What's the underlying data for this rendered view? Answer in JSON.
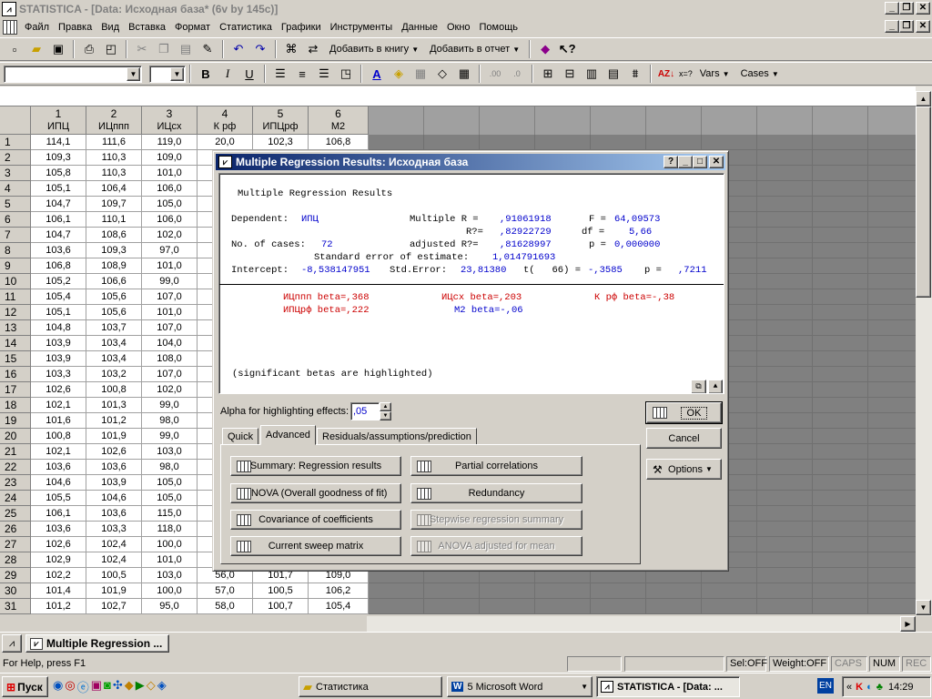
{
  "window": {
    "title": "STATISTICA - [Data: Исходная база* (6v by 145c)]",
    "icon": "statistica-icon"
  },
  "menu": [
    "Файл",
    "Правка",
    "Вид",
    "Вставка",
    "Формат",
    "Статистика",
    "Графики",
    "Инструменты",
    "Данные",
    "Окно",
    "Помощь"
  ],
  "toolbar1": {
    "add_to_workbook": "Добавить в книгу",
    "add_to_report": "Добавить в отчет"
  },
  "toolbar2": {
    "vars": "Vars",
    "cases": "Cases",
    "xeq": "x=?"
  },
  "sheet": {
    "columns": [
      {
        "num": "1",
        "name": "ИПЦ"
      },
      {
        "num": "2",
        "name": "ИЦппп"
      },
      {
        "num": "3",
        "name": "ИЦсх"
      },
      {
        "num": "4",
        "name": "К рф"
      },
      {
        "num": "5",
        "name": "ИПЦрф"
      },
      {
        "num": "6",
        "name": "М2"
      }
    ],
    "rows": [
      [
        "1",
        "114,1",
        "111,6",
        "119,0",
        "20,0",
        "102,3",
        "106,8"
      ],
      [
        "2",
        "109,3",
        "110,3",
        "109,0",
        "",
        "",
        ""
      ],
      [
        "3",
        "105,8",
        "110,3",
        "101,0",
        "",
        "",
        ""
      ],
      [
        "4",
        "105,1",
        "106,4",
        "106,0",
        "",
        "",
        ""
      ],
      [
        "5",
        "104,7",
        "109,7",
        "105,0",
        "",
        "",
        ""
      ],
      [
        "6",
        "106,1",
        "110,1",
        "106,0",
        "",
        "",
        ""
      ],
      [
        "7",
        "104,7",
        "108,6",
        "102,0",
        "",
        "",
        ""
      ],
      [
        "8",
        "103,6",
        "109,3",
        "97,0",
        "",
        "",
        ""
      ],
      [
        "9",
        "106,8",
        "108,9",
        "101,0",
        "",
        "",
        ""
      ],
      [
        "10",
        "105,2",
        "106,6",
        "99,0",
        "",
        "",
        ""
      ],
      [
        "11",
        "105,4",
        "105,6",
        "107,0",
        "",
        "",
        ""
      ],
      [
        "12",
        "105,1",
        "105,6",
        "101,0",
        "",
        "",
        ""
      ],
      [
        "13",
        "104,8",
        "103,7",
        "107,0",
        "",
        "",
        ""
      ],
      [
        "14",
        "103,9",
        "103,4",
        "104,0",
        "",
        "",
        ""
      ],
      [
        "15",
        "103,9",
        "103,4",
        "108,0",
        "",
        "",
        ""
      ],
      [
        "16",
        "103,3",
        "103,2",
        "107,0",
        "",
        "",
        ""
      ],
      [
        "17",
        "102,6",
        "100,8",
        "102,0",
        "",
        "",
        ""
      ],
      [
        "18",
        "102,1",
        "101,3",
        "99,0",
        "",
        "",
        ""
      ],
      [
        "19",
        "101,6",
        "101,2",
        "98,0",
        "",
        "",
        ""
      ],
      [
        "20",
        "100,8",
        "101,9",
        "99,0",
        "",
        "",
        ""
      ],
      [
        "21",
        "102,1",
        "102,6",
        "103,0",
        "",
        "",
        ""
      ],
      [
        "22",
        "103,6",
        "103,6",
        "98,0",
        "",
        "",
        ""
      ],
      [
        "23",
        "104,6",
        "103,9",
        "105,0",
        "",
        "",
        ""
      ],
      [
        "24",
        "105,5",
        "104,6",
        "105,0",
        "",
        "",
        ""
      ],
      [
        "25",
        "106,1",
        "103,6",
        "115,0",
        "",
        "",
        ""
      ],
      [
        "26",
        "103,6",
        "103,3",
        "118,0",
        "",
        "",
        ""
      ],
      [
        "27",
        "102,6",
        "102,4",
        "100,0",
        "",
        "",
        ""
      ],
      [
        "28",
        "102,9",
        "102,4",
        "101,0",
        "",
        "",
        ""
      ],
      [
        "29",
        "102,2",
        "100,5",
        "103,0",
        "56,0",
        "101,7",
        "109,0"
      ],
      [
        "30",
        "101,4",
        "101,9",
        "100,0",
        "57,0",
        "100,5",
        "106,2"
      ],
      [
        "31",
        "101,2",
        "102,7",
        "95,0",
        "58,0",
        "100,7",
        "105,4"
      ]
    ]
  },
  "dialog": {
    "title": "Multiple Regression Results: Исходная база",
    "report": {
      "heading": "Multiple Regression Results",
      "dependent_label": "Dependent:",
      "dependent": "ИПЦ",
      "multiple_r_label": "Multiple R =",
      "multiple_r": ",91061918",
      "f_label": "F =",
      "f": "64,09573",
      "r2_label": "R?=",
      "r2": ",82922729",
      "df_label": "df =",
      "df": "5,66",
      "cases_label": "No. of cases:",
      "cases": "72",
      "adj_r2_label": "adjusted R?=",
      "adj_r2": ",81628997",
      "p_label": "p =",
      "p": "0,000000",
      "se_label": "Standard error of estimate:",
      "se": "1,014791693",
      "intercept_label": "Intercept:",
      "intercept": "-8,538147951",
      "std_err_label": "Std.Error:",
      "std_err": "23,81380",
      "t_label": "t(   66) =",
      "t": "-,3585",
      "p2_label": "p =",
      "p2": ",7211",
      "betas": [
        {
          "text": "ИЦппп beta=,368",
          "highlighted": true
        },
        {
          "text": "ИЦсх beta=,203",
          "highlighted": true
        },
        {
          "text": "К рф beta=-,38",
          "highlighted": true
        },
        {
          "text": "ИПЦрф beta=,222",
          "highlighted": true
        },
        {
          "text": "М2 beta=-,06",
          "highlighted": false
        }
      ],
      "note": "(significant betas are highlighted)"
    },
    "alpha_label": "Alpha for highlighting effects:",
    "alpha_value": ",05",
    "tabs": [
      "Quick",
      "Advanced",
      "Residuals/assumptions/prediction"
    ],
    "active_tab": "Advanced",
    "buttons": {
      "summary": "Summary:  Regression results",
      "anova": "ANOVA (Overall goodness of fit)",
      "covariance": "Covariance of coefficients",
      "sweep": "Current sweep matrix",
      "partial": "Partial correlations",
      "redundancy": "Redundancy",
      "stepwise": "Stepwise regression summary",
      "anova_mean": "ANOVA adjusted for mean"
    },
    "ok": "OK",
    "cancel": "Cancel",
    "options": "Options"
  },
  "mdi_task": "Multiple Regression ...",
  "status": {
    "help": "For Help, press F1",
    "sel": "Sel:OFF",
    "weight": "Weight:OFF",
    "caps": "CAPS",
    "num": "NUM",
    "rec": "REC"
  },
  "taskbar": {
    "start": "Пуск",
    "t1": "Статистика",
    "t2": "5 Microsoft Word",
    "t3": "STATISTICA - [Data: ...",
    "lang": "EN",
    "time": "14:29"
  },
  "colors": {
    "beta_highlight": "#cc0000",
    "value_blue": "#0000cc",
    "titlebar_active": "#0a246a"
  }
}
